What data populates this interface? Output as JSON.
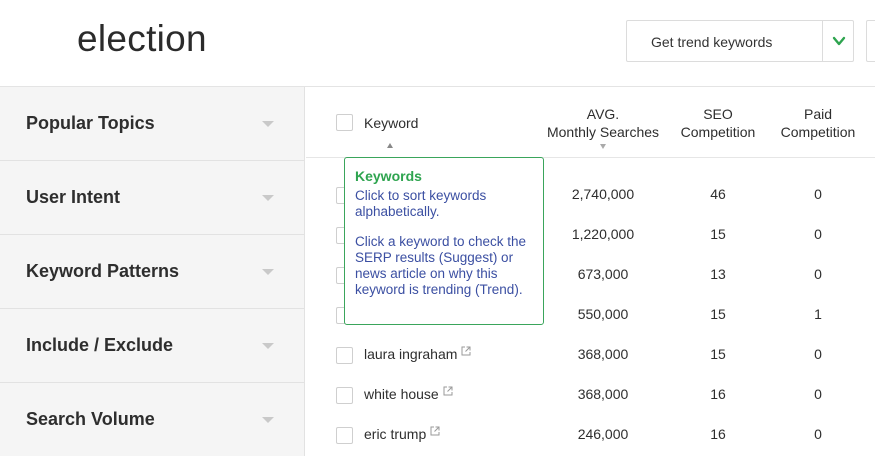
{
  "header": {
    "title": "election",
    "trend_select_label": "Get trend keywords",
    "accent": "#2ea44f"
  },
  "sidebar": {
    "items": [
      {
        "label": "Popular Topics"
      },
      {
        "label": "User Intent"
      },
      {
        "label": "Keyword Patterns"
      },
      {
        "label": "Include / Exclude"
      },
      {
        "label": "Search Volume"
      }
    ]
  },
  "table": {
    "columns": {
      "keyword": "Keyword",
      "avg_line1": "AVG.",
      "avg_line2": "Monthly Searches",
      "seo_line1": "SEO",
      "seo_line2": "Competition",
      "paid_line1": "Paid",
      "paid_line2": "Competition"
    },
    "rows": [
      {
        "keyword": "",
        "searches": "2,740,000",
        "seo": "46",
        "paid": "0"
      },
      {
        "keyword": "",
        "searches": "1,220,000",
        "seo": "15",
        "paid": "0"
      },
      {
        "keyword": "",
        "searches": "673,000",
        "seo": "13",
        "paid": "0"
      },
      {
        "keyword": "",
        "searches": "550,000",
        "seo": "15",
        "paid": "1"
      },
      {
        "keyword": "laura ingraham",
        "searches": "368,000",
        "seo": "15",
        "paid": "0"
      },
      {
        "keyword": "white house",
        "searches": "368,000",
        "seo": "16",
        "paid": "0"
      },
      {
        "keyword": "eric trump",
        "searches": "246,000",
        "seo": "16",
        "paid": "0"
      }
    ]
  },
  "tooltip": {
    "title": "Keywords",
    "line1": "Click to sort keywords alphabetically.",
    "line2": "Click a keyword to check the SERP results (Suggest) or news article on why this keyword is trending (Trend).",
    "border_color": "#3aa55b",
    "text_color": "#3b4fa2"
  }
}
